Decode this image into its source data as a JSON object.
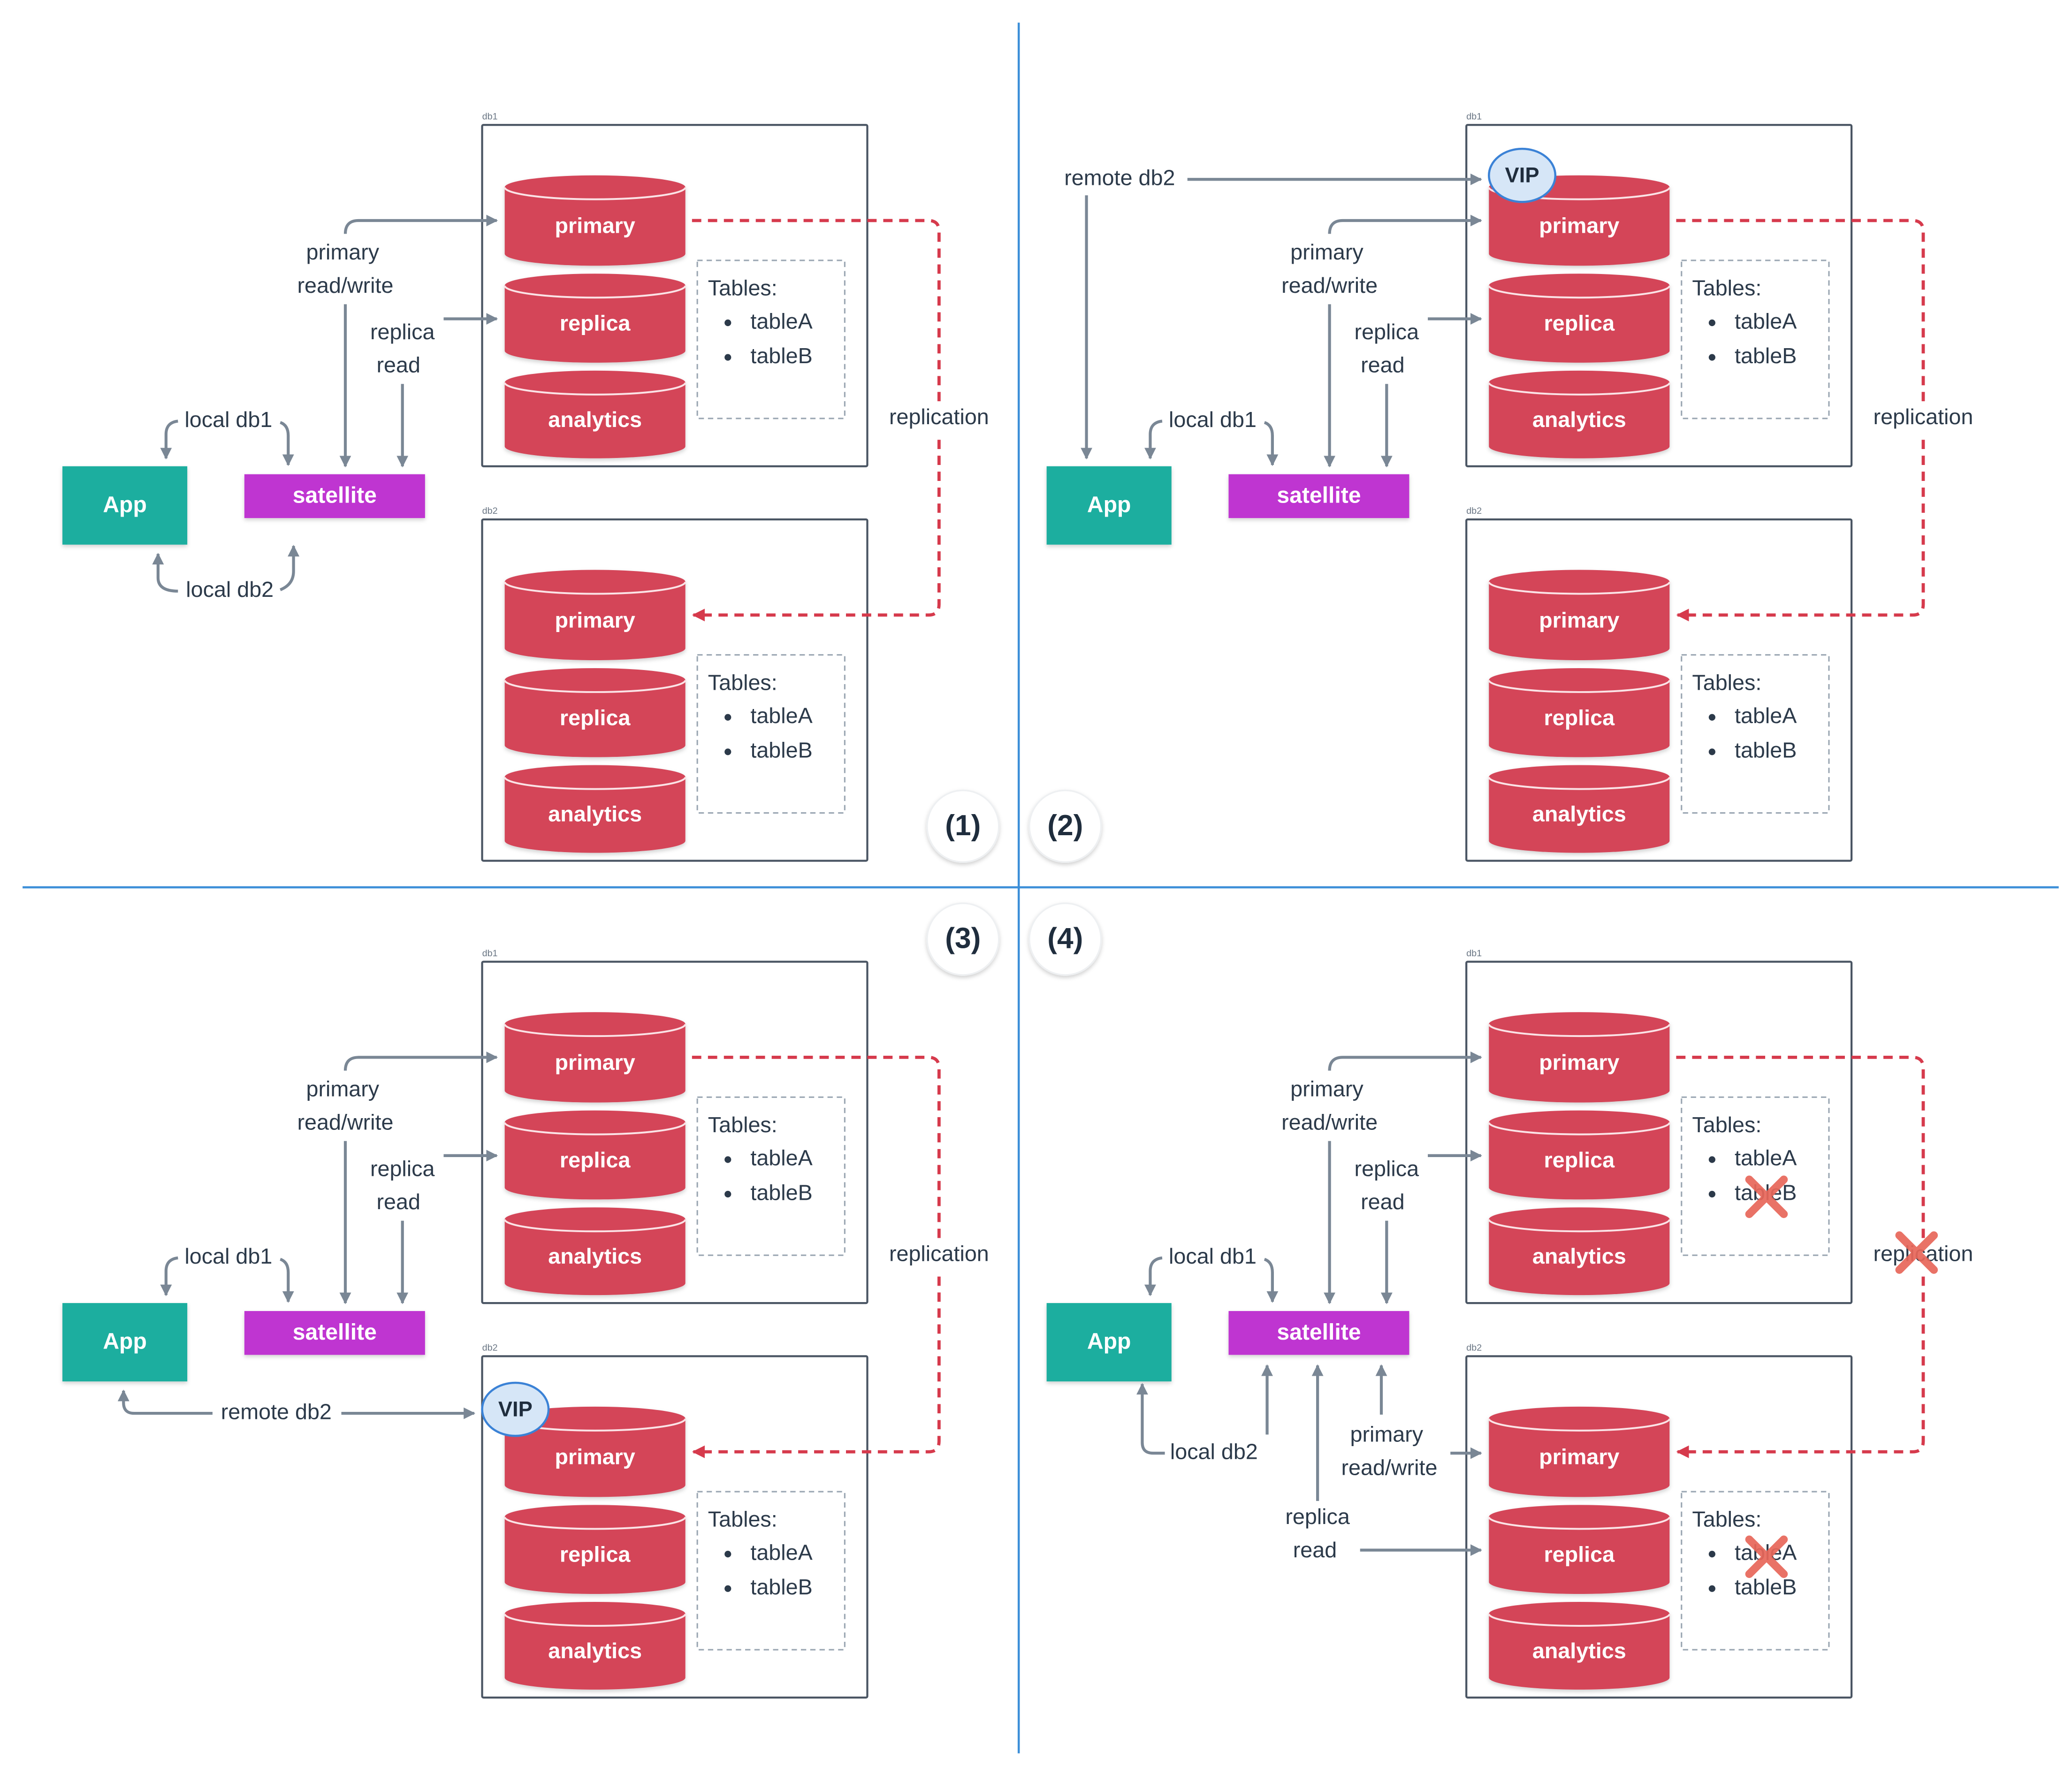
{
  "colors": {
    "divider": "#3d8fd8",
    "cylinder": "#d44458",
    "app": "#1aae9f",
    "satellite": "#bf35d1",
    "arrow": "#7a8795",
    "replication": "#d63a4c",
    "vip_fill": "#d6e6f7",
    "vip_stroke": "#3b82d6",
    "failure_mark": "#e8675a"
  },
  "quadrants": [
    {
      "step": "(1)",
      "app": "App",
      "satellite": "satellite",
      "db1": {
        "name": "db1",
        "cylinders": [
          "primary",
          "replica",
          "analytics"
        ],
        "tables_title": "Tables:",
        "tables": [
          "tableA",
          "tableB"
        ]
      },
      "db2": {
        "name": "db2",
        "cylinders": [
          "primary",
          "replica",
          "analytics"
        ],
        "tables_title": "Tables:",
        "tables": [
          "tableA",
          "tableB"
        ]
      },
      "primary_rw": [
        "primary",
        "read/write"
      ],
      "replica_read": [
        "replica",
        "read"
      ],
      "local_db1": "local db1",
      "local_db2": "local db2",
      "replication": "replication"
    },
    {
      "step": "(2)",
      "app": "App",
      "satellite": "satellite",
      "db1": {
        "name": "db1",
        "cylinders": [
          "primary",
          "replica",
          "analytics"
        ],
        "tables_title": "Tables:",
        "tables": [
          "tableA",
          "tableB"
        ]
      },
      "db2": {
        "name": "db2",
        "cylinders": [
          "primary",
          "replica",
          "analytics"
        ],
        "tables_title": "Tables:",
        "tables": [
          "tableA",
          "tableB"
        ]
      },
      "primary_rw": [
        "primary",
        "read/write"
      ],
      "replica_read": [
        "replica",
        "read"
      ],
      "local_db1": "local db1",
      "remote_db2": "remote db2",
      "vip": "VIP",
      "vip_target": "db1",
      "replication": "replication"
    },
    {
      "step": "(3)",
      "app": "App",
      "satellite": "satellite",
      "db1": {
        "name": "db1",
        "cylinders": [
          "primary",
          "replica",
          "analytics"
        ],
        "tables_title": "Tables:",
        "tables": [
          "tableA",
          "tableB"
        ]
      },
      "db2": {
        "name": "db2",
        "cylinders": [
          "primary",
          "replica",
          "analytics"
        ],
        "tables_title": "Tables:",
        "tables": [
          "tableA",
          "tableB"
        ]
      },
      "primary_rw": [
        "primary",
        "read/write"
      ],
      "replica_read": [
        "replica",
        "read"
      ],
      "local_db1": "local db1",
      "remote_db2": "remote db2",
      "vip": "VIP",
      "vip_target": "db2",
      "replication": "replication"
    },
    {
      "step": "(4)",
      "app": "App",
      "satellite": "satellite",
      "db1": {
        "name": "db1",
        "cylinders": [
          "primary",
          "replica",
          "analytics"
        ],
        "tables_title": "Tables:",
        "tables": [
          "tableA",
          "tableB"
        ],
        "failed_table": "tableB"
      },
      "db2": {
        "name": "db2",
        "cylinders": [
          "primary",
          "replica",
          "analytics"
        ],
        "tables_title": "Tables:",
        "tables": [
          "tableA",
          "tableB"
        ],
        "failed_table": "tableA"
      },
      "primary_rw": [
        "primary",
        "read/write"
      ],
      "replica_read": [
        "replica",
        "read"
      ],
      "db2_primary_rw": [
        "primary",
        "read/write"
      ],
      "db2_replica_read": [
        "replica",
        "read"
      ],
      "local_db1": "local db1",
      "local_db2": "local db2",
      "replication": "replication",
      "replication_failed": true
    }
  ]
}
